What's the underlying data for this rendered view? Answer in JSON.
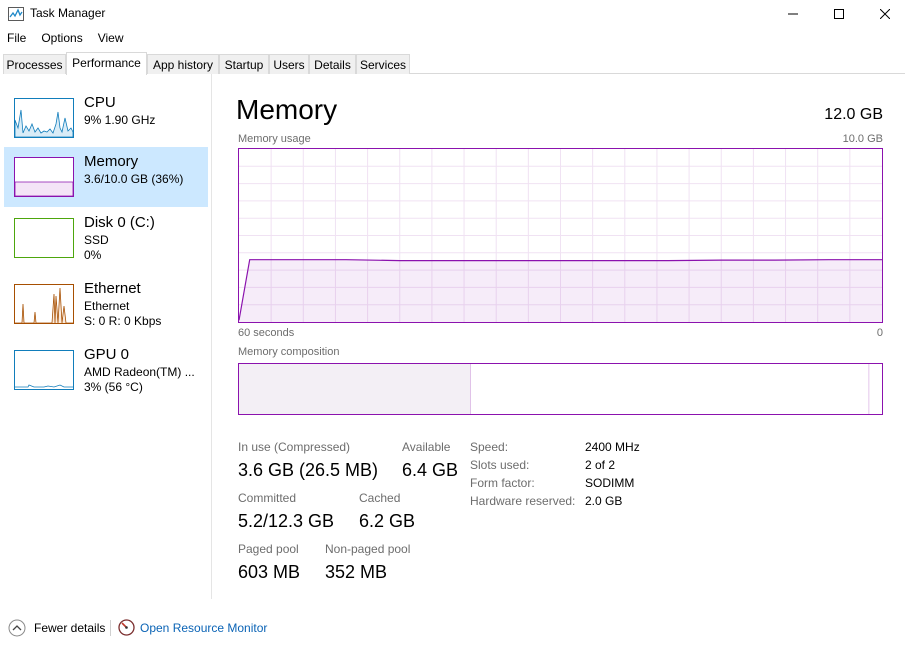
{
  "window": {
    "title": "Task Manager"
  },
  "menu": [
    "File",
    "Options",
    "View"
  ],
  "tabs": [
    "Processes",
    "Performance",
    "App history",
    "Startup",
    "Users",
    "Details",
    "Services"
  ],
  "active_tab": "Performance",
  "sidebar": [
    {
      "name": "CPU",
      "line1": "9%  1.90 GHz",
      "line2": "",
      "color": "#117dbb"
    },
    {
      "name": "Memory",
      "line1": "3.6/10.0 GB (36%)",
      "line2": "",
      "color": "#8b12ae"
    },
    {
      "name": "Disk 0 (C:)",
      "line1": "SSD",
      "line2": "0%",
      "color": "#4da60c"
    },
    {
      "name": "Ethernet",
      "line1": "Ethernet",
      "line2": "S: 0  R: 0 Kbps",
      "color": "#a74f01"
    },
    {
      "name": "GPU 0",
      "line1": "AMD Radeon(TM) ...",
      "line2": "3%  (56 °C)",
      "color": "#117dbb"
    }
  ],
  "main": {
    "title": "Memory",
    "total": "12.0 GB",
    "usage_label": "Memory usage",
    "usage_max": "10.0 GB",
    "axis_left": "60 seconds",
    "axis_right": "0",
    "composition_label": "Memory composition"
  },
  "chart_data": {
    "type": "area",
    "title": "Memory usage",
    "xlabel": "",
    "ylabel": "",
    "xlim": [
      60,
      0
    ],
    "ylim": [
      0,
      10.0
    ],
    "grid": true,
    "x": [
      60,
      59,
      55,
      50,
      45,
      40,
      35,
      30,
      25,
      20,
      15,
      10,
      5,
      0
    ],
    "series": [
      {
        "values": [
          0.1,
          3.6,
          3.6,
          3.6,
          3.55,
          3.55,
          3.55,
          3.55,
          3.55,
          3.55,
          3.58,
          3.58,
          3.6,
          3.6
        ]
      }
    ],
    "composition": {
      "in_use_fraction": 0.36,
      "modified_fraction": 0.0,
      "standby_fraction": 0.62,
      "free_fraction": 0.02
    }
  },
  "stats": {
    "in_use_label": "In use (Compressed)",
    "in_use_value": "3.6 GB (26.5 MB)",
    "available_label": "Available",
    "available_value": "6.4 GB",
    "committed_label": "Committed",
    "committed_value": "5.2/12.3 GB",
    "cached_label": "Cached",
    "cached_value": "6.2 GB",
    "paged_label": "Paged pool",
    "paged_value": "603 MB",
    "nonpaged_label": "Non-paged pool",
    "nonpaged_value": "352 MB"
  },
  "specs": [
    {
      "label": "Speed:",
      "value": "2400 MHz"
    },
    {
      "label": "Slots used:",
      "value": "2 of 2"
    },
    {
      "label": "Form factor:",
      "value": "SODIMM"
    },
    {
      "label": "Hardware reserved:",
      "value": "2.0 GB"
    }
  ],
  "footer": {
    "fewer_details": "Fewer details",
    "resource_monitor": "Open Resource Monitor"
  }
}
